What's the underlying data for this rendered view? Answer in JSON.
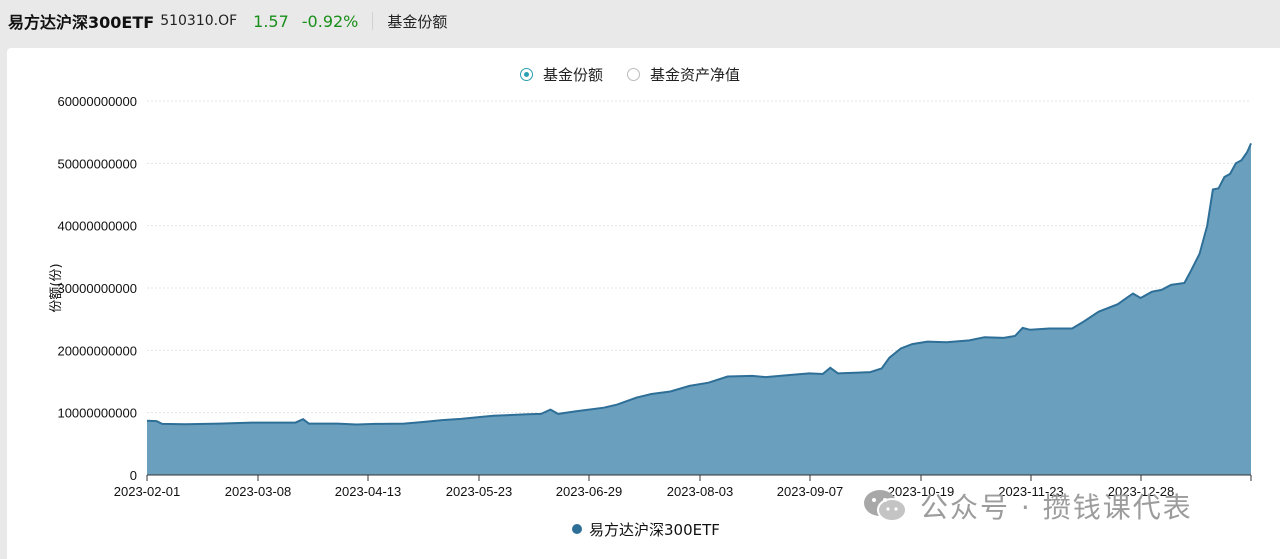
{
  "header": {
    "fund_name": "易方达沪深300ETF",
    "fund_code": "510310.OF",
    "price": "1.57",
    "change": "-0.92%",
    "tab": "基金份额"
  },
  "toggle": {
    "options": [
      {
        "label": "基金份额",
        "checked": true
      },
      {
        "label": "基金资产净值",
        "checked": false
      }
    ]
  },
  "colors": {
    "area": "#6b9fbe",
    "line": "#2e6f98",
    "accent": "#2a9fb0",
    "up": "#1a8f1a"
  },
  "chart_data": {
    "type": "area",
    "ylabel": "份额(份)",
    "ylim": [
      0,
      60000000000
    ],
    "y_ticks": [
      "0",
      "10000000000",
      "20000000000",
      "30000000000",
      "40000000000",
      "50000000000",
      "60000000000"
    ],
    "x_ticks": [
      "2023-02-01",
      "2023-03-08",
      "2023-04-13",
      "2023-05-23",
      "2023-06-29",
      "2023-08-03",
      "2023-09-07",
      "2023-10-19",
      "2023-11-23",
      "2023-12-28"
    ],
    "grid": true,
    "legend_position": "bottom-center",
    "series": [
      {
        "name": "易方达沪深300ETF",
        "points": [
          [
            0,
            8700000000
          ],
          [
            5,
            8650000000
          ],
          [
            8,
            8200000000
          ],
          [
            20,
            8150000000
          ],
          [
            38,
            8250000000
          ],
          [
            55,
            8400000000
          ],
          [
            78,
            8400000000
          ],
          [
            82,
            8950000000
          ],
          [
            85,
            8250000000
          ],
          [
            100,
            8250000000
          ],
          [
            110,
            8100000000
          ],
          [
            120,
            8200000000
          ],
          [
            135,
            8250000000
          ],
          [
            145,
            8500000000
          ],
          [
            155,
            8800000000
          ],
          [
            165,
            9000000000
          ],
          [
            175,
            9300000000
          ],
          [
            182,
            9500000000
          ],
          [
            200,
            9750000000
          ],
          [
            207,
            9800000000
          ],
          [
            212,
            10500000000
          ],
          [
            216,
            9800000000
          ],
          [
            225,
            10200000000
          ],
          [
            240,
            10800000000
          ],
          [
            247,
            11300000000
          ],
          [
            257,
            12400000000
          ],
          [
            265,
            13000000000
          ],
          [
            275,
            13400000000
          ],
          [
            285,
            14300000000
          ],
          [
            295,
            14800000000
          ],
          [
            305,
            15800000000
          ],
          [
            318,
            15900000000
          ],
          [
            325,
            15700000000
          ],
          [
            340,
            16100000000
          ],
          [
            348,
            16300000000
          ],
          [
            355,
            16200000000
          ],
          [
            359,
            17200000000
          ],
          [
            363,
            16300000000
          ],
          [
            372,
            16400000000
          ],
          [
            380,
            16500000000
          ],
          [
            386,
            17100000000
          ],
          [
            390,
            18800000000
          ],
          [
            396,
            20300000000
          ],
          [
            402,
            21000000000
          ],
          [
            410,
            21400000000
          ],
          [
            420,
            21300000000
          ],
          [
            432,
            21600000000
          ],
          [
            440,
            22100000000
          ],
          [
            450,
            22000000000
          ],
          [
            456,
            22300000000
          ],
          [
            460,
            23600000000
          ],
          [
            464,
            23300000000
          ],
          [
            474,
            23500000000
          ],
          [
            486,
            23500000000
          ],
          [
            492,
            24600000000
          ],
          [
            500,
            26200000000
          ],
          [
            510,
            27400000000
          ],
          [
            515,
            28500000000
          ],
          [
            518,
            29100000000
          ],
          [
            522,
            28400000000
          ],
          [
            528,
            29400000000
          ],
          [
            533,
            29700000000
          ],
          [
            538,
            30500000000
          ],
          [
            545,
            30800000000
          ],
          [
            548,
            32500000000
          ],
          [
            553,
            35500000000
          ],
          [
            557,
            40000000000
          ],
          [
            560,
            45800000000
          ],
          [
            563,
            46000000000
          ],
          [
            566,
            47800000000
          ],
          [
            569,
            48300000000
          ],
          [
            572,
            50000000000
          ],
          [
            575,
            50500000000
          ],
          [
            578,
            51800000000
          ],
          [
            580,
            53200000000
          ]
        ]
      }
    ]
  },
  "watermark": "公众号 · 攒钱课代表"
}
